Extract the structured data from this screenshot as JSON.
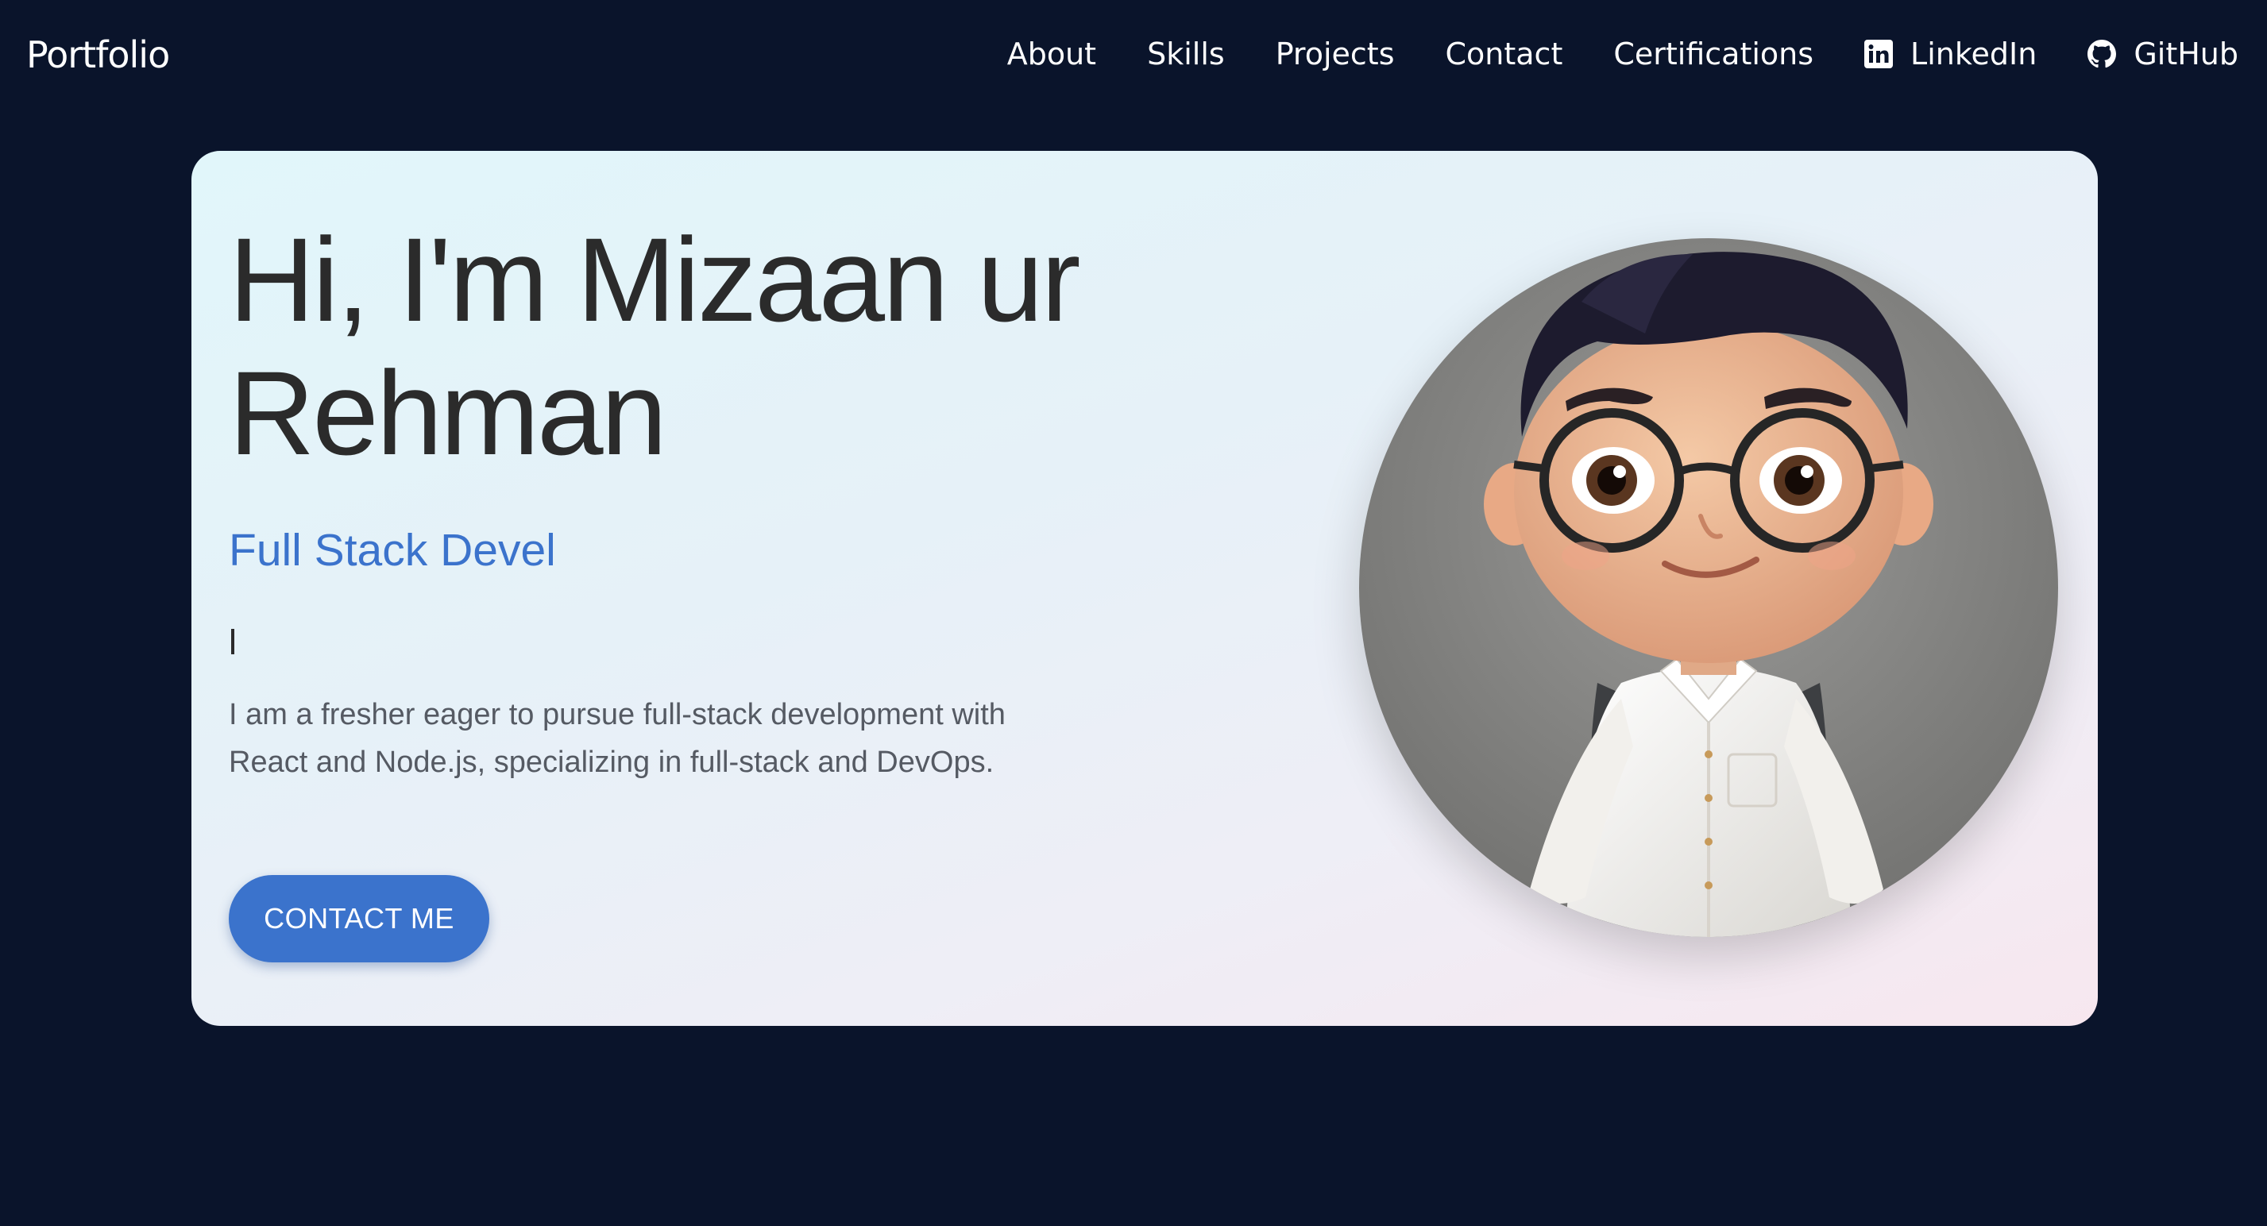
{
  "nav": {
    "brand": "Portfolio",
    "links": [
      {
        "label": "About"
      },
      {
        "label": "Skills"
      },
      {
        "label": "Projects"
      },
      {
        "label": "Contact"
      },
      {
        "label": "Certifications"
      },
      {
        "label": "LinkedIn",
        "icon": "linkedin-icon"
      },
      {
        "label": "GitHub",
        "icon": "github-icon"
      }
    ]
  },
  "hero": {
    "headline": "Hi, I'm Mizaan ur Rehman",
    "subtitle": "Full Stack Devel",
    "description": "I am a fresher eager to pursue full-stack development with React and Node.js, specializing in full-stack and DevOps.",
    "cta_label": "CONTACT ME",
    "avatar": "cartoon-avatar-illustration"
  },
  "colors": {
    "page_bg": "#0a142b",
    "accent": "#3b73cc",
    "heading": "#2b2b2b",
    "body_text": "#555a63"
  }
}
